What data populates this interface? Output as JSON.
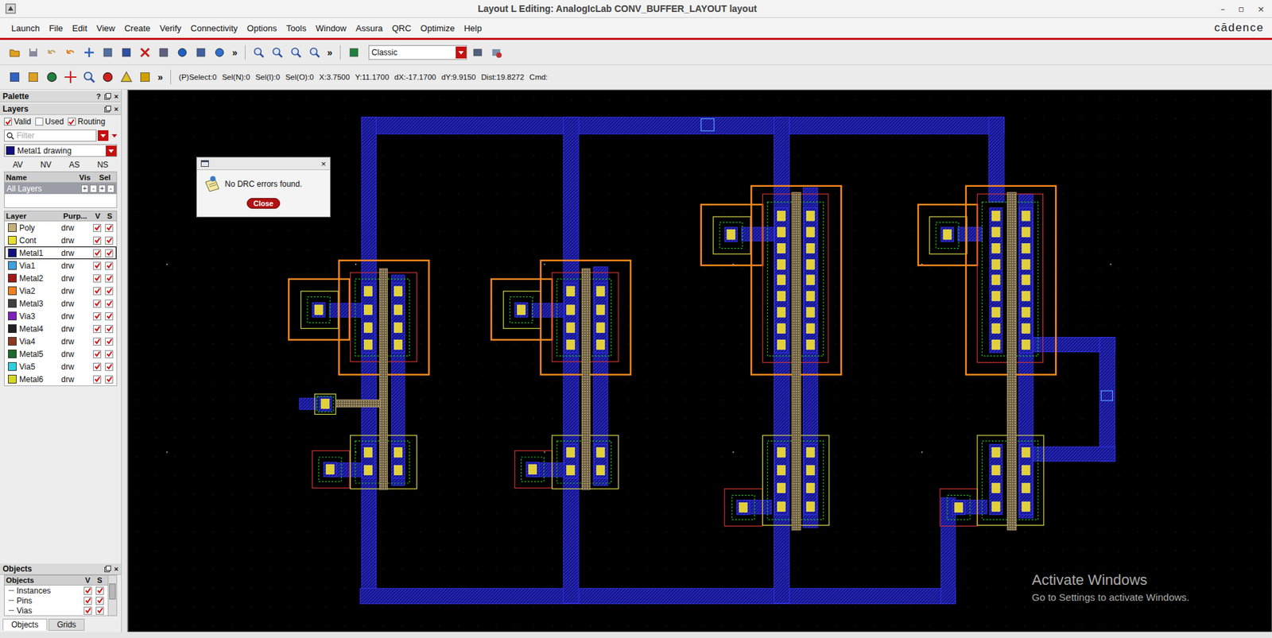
{
  "window": {
    "title": "Layout L Editing: AnalogIcLab CONV_BUFFER_LAYOUT layout",
    "controls": [
      "–",
      "▫",
      "×"
    ]
  },
  "menu": [
    "Launch",
    "File",
    "Edit",
    "View",
    "Create",
    "Verify",
    "Connectivity",
    "Options",
    "Tools",
    "Window",
    "Assura",
    "QRC",
    "Optimize",
    "Help"
  ],
  "brand": "cādence",
  "toolbar": {
    "overflow_marks": [
      "»",
      "»"
    ],
    "mode": "Classic"
  },
  "toolbar2": {
    "overflow_mark": "»",
    "status": [
      "(P)Select:0",
      "Sel(N):0",
      "Sel(I):0",
      "Sel(O):0",
      "X:3.7500",
      "Y:11.1700",
      "dX:-17.1700",
      "dY:9.9150",
      "Dist:19.8272",
      "Cmd:"
    ]
  },
  "palette": {
    "title": "Palette",
    "buttons": [
      "?",
      "×"
    ]
  },
  "layers_panel": {
    "title": "Layers",
    "buttons": [
      "×"
    ]
  },
  "layer_filters": [
    {
      "label": "Valid",
      "checked": true
    },
    {
      "label": "Used",
      "checked": false
    },
    {
      "label": "Routing",
      "checked": true
    }
  ],
  "filter": {
    "placeholder": "Filter"
  },
  "current_layer": {
    "name": "Metal1 drawing",
    "color": "#101080"
  },
  "visibility_buttons": [
    "AV",
    "NV",
    "AS",
    "NS"
  ],
  "layer_sets": {
    "columns": [
      "Name",
      "Vis",
      "Sel"
    ],
    "rows": [
      {
        "name": "All Layers",
        "buttons": [
          "+",
          "-",
          "+",
          "-"
        ],
        "selected": true
      }
    ]
  },
  "layers": {
    "columns": [
      "Layer",
      "Purp...",
      "V",
      "S"
    ],
    "rows": [
      {
        "name": "Poly",
        "purpose": "drw",
        "visible": true,
        "selectable": true,
        "selected": false,
        "color": "#c8b07a"
      },
      {
        "name": "Cont",
        "purpose": "drw",
        "visible": true,
        "selectable": true,
        "selected": false,
        "color": "#e8e030"
      },
      {
        "name": "Metal1",
        "purpose": "drw",
        "visible": true,
        "selectable": true,
        "selected": true,
        "color": "#101080"
      },
      {
        "name": "Via1",
        "purpose": "drw",
        "visible": true,
        "selectable": true,
        "selected": false,
        "color": "#40a0e0"
      },
      {
        "name": "Metal2",
        "purpose": "drw",
        "visible": true,
        "selectable": true,
        "selected": false,
        "color": "#a01818"
      },
      {
        "name": "Via2",
        "purpose": "drw",
        "visible": true,
        "selectable": true,
        "selected": false,
        "color": "#f08020"
      },
      {
        "name": "Metal3",
        "purpose": "drw",
        "visible": true,
        "selectable": true,
        "selected": false,
        "color": "#404040"
      },
      {
        "name": "Via3",
        "purpose": "drw",
        "visible": true,
        "selectable": true,
        "selected": false,
        "color": "#8020c0"
      },
      {
        "name": "Metal4",
        "purpose": "drw",
        "visible": true,
        "selectable": true,
        "selected": false,
        "color": "#202020"
      },
      {
        "name": "Via4",
        "purpose": "drw",
        "visible": true,
        "selectable": true,
        "selected": false,
        "color": "#8a3a20"
      },
      {
        "name": "Metal5",
        "purpose": "drw",
        "visible": true,
        "selectable": true,
        "selected": false,
        "color": "#1c6a2c"
      },
      {
        "name": "Via5",
        "purpose": "drw",
        "visible": true,
        "selectable": true,
        "selected": false,
        "color": "#30d0e0"
      },
      {
        "name": "Metal6",
        "purpose": "drw",
        "visible": true,
        "selectable": true,
        "selected": false,
        "color": "#d8d820"
      }
    ]
  },
  "objects": {
    "title": "Objects",
    "buttons": [
      "×"
    ],
    "columns": [
      "Objects",
      "V",
      "S"
    ],
    "rows": [
      {
        "name": "Instances",
        "visible": true,
        "selectable": true
      },
      {
        "name": "Pins",
        "visible": true,
        "selectable": true
      },
      {
        "name": "Vias",
        "visible": true,
        "selectable": true
      }
    ]
  },
  "bottom_tabs": [
    {
      "label": "Objects",
      "selected": true
    },
    {
      "label": "Grids",
      "selected": false
    }
  ],
  "dialog": {
    "close_glyph": "×",
    "message": "No DRC errors found.",
    "button": "Close"
  },
  "watermark": {
    "title": "Activate Windows",
    "subtitle": "Go to Settings to activate Windows."
  }
}
